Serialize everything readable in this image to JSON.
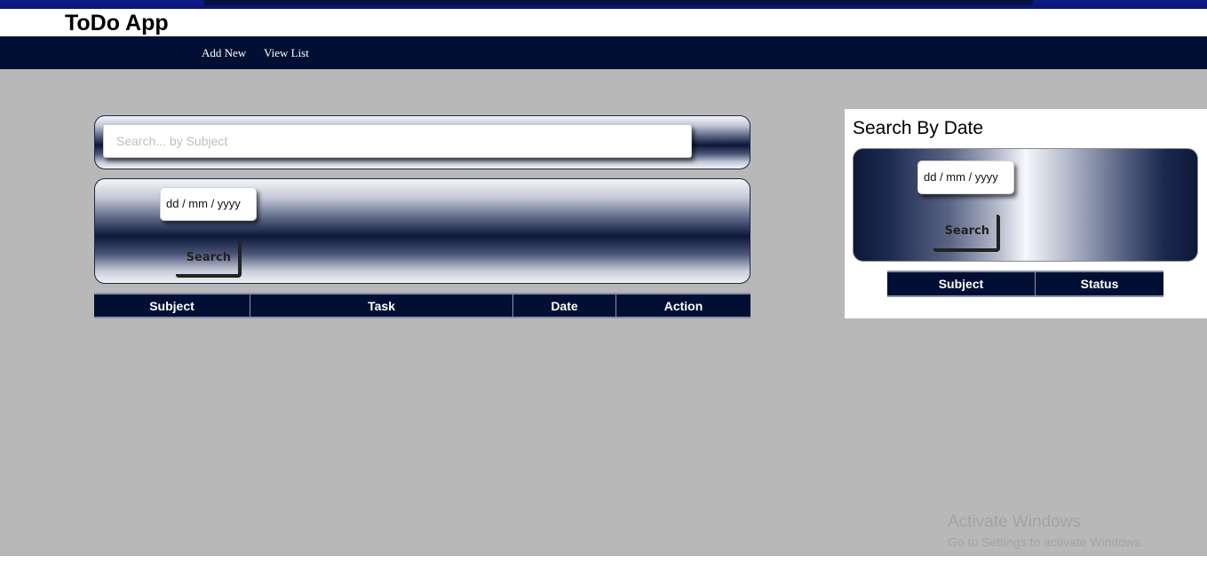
{
  "app": {
    "title": "ToDo App"
  },
  "nav": {
    "items": [
      {
        "label": "Add New"
      },
      {
        "label": "View List"
      }
    ]
  },
  "search_subject": {
    "placeholder": "Search... by Subject",
    "value": ""
  },
  "date_filter": {
    "date_placeholder": "dd / mm / yyyy",
    "button_label": "Search"
  },
  "main_table": {
    "columns": [
      "Subject",
      "Task",
      "Date",
      "Action"
    ],
    "rows": []
  },
  "side_panel": {
    "title": "Search By Date",
    "date_placeholder": "dd / mm / yyyy",
    "button_label": "Search",
    "table": {
      "columns": [
        "Subject",
        "Status"
      ],
      "rows": []
    }
  },
  "watermark": {
    "title": "Activate Windows",
    "subtitle": "Go to Settings to activate Windows."
  },
  "colors": {
    "navbar": "#000f33",
    "background": "#b8b8b8",
    "table_header": "#000f33"
  }
}
